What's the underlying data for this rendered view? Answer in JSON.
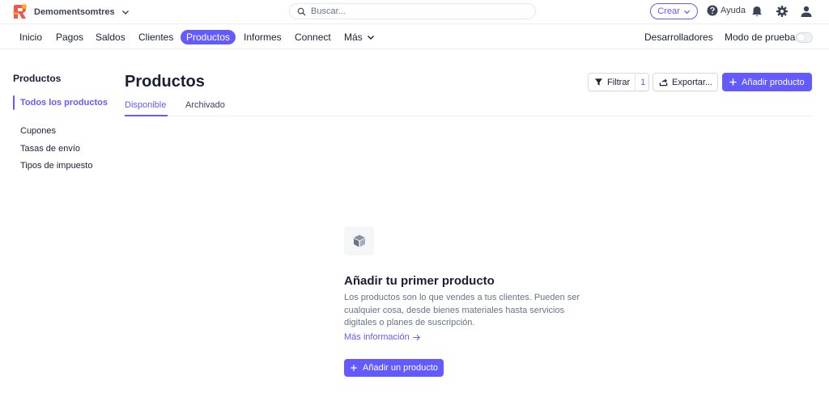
{
  "topbar": {
    "account_name": "Demomentsomtres",
    "search_placeholder": "Buscar...",
    "create_label": "Crear",
    "help_label": "Ayuda"
  },
  "nav": {
    "items": [
      {
        "label": "Inicio"
      },
      {
        "label": "Pagos"
      },
      {
        "label": "Saldos"
      },
      {
        "label": "Clientes"
      },
      {
        "label": "Productos",
        "active": true
      },
      {
        "label": "Informes"
      },
      {
        "label": "Connect"
      },
      {
        "label": "Más"
      }
    ],
    "developers_label": "Desarrolladores",
    "test_mode_label": "Modo de prueba",
    "test_mode_on": false
  },
  "sidebar": {
    "title": "Productos",
    "items": [
      {
        "label": "Todos los productos",
        "active": true
      },
      {
        "label": "Cupones"
      },
      {
        "label": "Tasas de envío"
      },
      {
        "label": "Tipos de impuesto"
      }
    ]
  },
  "main": {
    "title": "Productos",
    "filter_label": "Filtrar",
    "filter_count": "1",
    "export_label": "Exportar...",
    "add_product_label": "Añadir producto",
    "tabs": [
      {
        "label": "Disponible",
        "active": true
      },
      {
        "label": "Archivado"
      }
    ]
  },
  "empty_state": {
    "title": "Añadir tu primer producto",
    "description": "Los productos son lo que vendes a tus clientes. Pueden ser cualquier cosa, desde bienes materiales hasta servicios digitales o planes de suscripción.",
    "link_label": "Más información",
    "button_label": "Añadir un producto"
  },
  "colors": {
    "accent": "#635bff",
    "text": "#1a1f36",
    "muted": "#687385"
  }
}
